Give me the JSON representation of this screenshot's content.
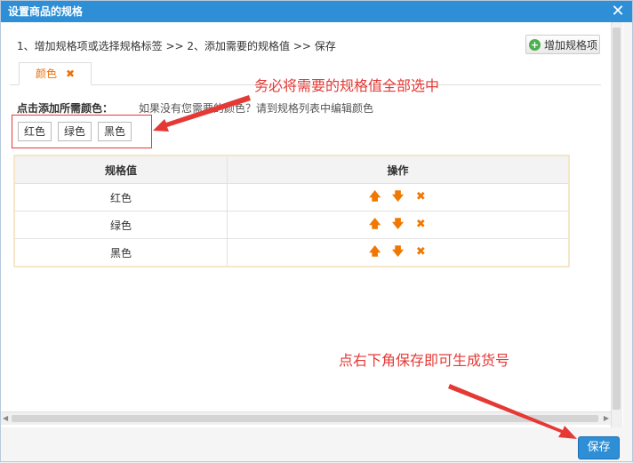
{
  "window": {
    "title": "设置商品的规格",
    "close_icon": "close-icon"
  },
  "steps": "1、增加规格项或选择规格标签 >> 2、添加需要的规格值 >> 保存",
  "add_spec_button": "增加规格项",
  "tab": {
    "label": "颜色",
    "remove": "✖"
  },
  "picker": {
    "label": "点击添加所需颜色：",
    "hint": "如果没有您需要的颜色？请到规格列表中编辑颜色",
    "chips": [
      "红色",
      "绿色",
      "黑色"
    ]
  },
  "table": {
    "headers": [
      "规格值",
      "操作"
    ],
    "rows": [
      {
        "value": "红色"
      },
      {
        "value": "绿色"
      },
      {
        "value": "黑色"
      }
    ],
    "ops": {
      "up": "🡅",
      "down": "🡇",
      "delete": "✖"
    }
  },
  "annotations": {
    "note1": "务必将需要的规格值全部选中",
    "note2": "点右下角保存即可生成货号",
    "color": "#e53935"
  },
  "save_button": "保存",
  "colors": {
    "title_bar": "#2e8fd6",
    "accent": "#e8720c"
  }
}
